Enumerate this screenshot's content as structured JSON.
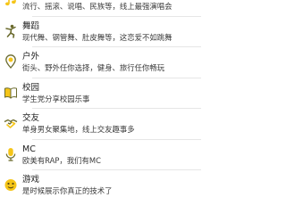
{
  "accent_color": "#f5c518",
  "categories": [
    {
      "title": "",
      "desc": "流行、摇滚、说唱、民族等，线上最强演唱会",
      "icon": "music-icon"
    },
    {
      "title": "舞蹈",
      "desc": "现代舞、钢管舞、肚皮舞等，这恋爱不如跳舞",
      "icon": "dance-icon"
    },
    {
      "title": "户外",
      "desc": "街头、野外任你选择，健身、旅行任你畅玩",
      "icon": "location-pin-icon"
    },
    {
      "title": "校园",
      "desc": "学生党分享校园乐事",
      "icon": "book-icon"
    },
    {
      "title": "交友",
      "desc": "单身男女聚集地，线上交友趣事多",
      "icon": "handshake-icon"
    },
    {
      "title": "MC",
      "desc": "欧美有RAP，我们有MC",
      "icon": "microphone-icon"
    },
    {
      "title": "游戏",
      "desc": "是时候展示你真正的技术了",
      "icon": "gamepad-icon"
    }
  ]
}
